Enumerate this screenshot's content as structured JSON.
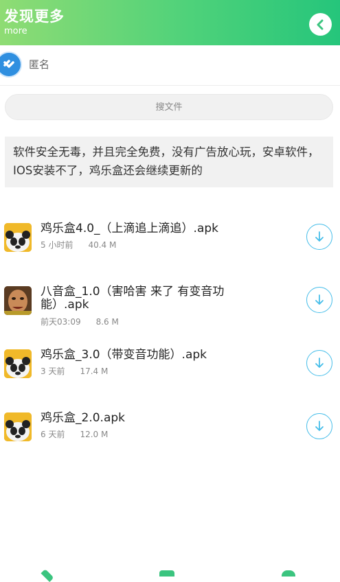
{
  "header": {
    "title": "发现更多",
    "subtitle": "more",
    "back_icon": "chevron-left-icon"
  },
  "user": {
    "name": "匿名",
    "avatar_icon": "user-avatar-icon"
  },
  "search": {
    "placeholder": "搜文件"
  },
  "description": "软件安全无毒，并且完全免费，没有广告放心玩，安卓软件，IOS安装不了，鸡乐盒还会继续更新的",
  "files": [
    {
      "name": "鸡乐盒4.0_（上滴追上滴追）.apk",
      "time": "5 小时前",
      "size": "40.4 M",
      "icon": "panda-app-icon"
    },
    {
      "name": "八音盒_1.0（害哈害 来了 有变音功能）.apk",
      "time": "前天03:09",
      "size": "8.6 M",
      "icon": "face-app-icon"
    },
    {
      "name": "鸡乐盒_3.0（带变音功能）.apk",
      "time": "3 天前",
      "size": "17.4 M",
      "icon": "panda-app-icon"
    },
    {
      "name": "鸡乐盒_2.0.apk",
      "time": "6 天前",
      "size": "12.0 M",
      "icon": "panda-app-icon"
    }
  ],
  "colors": {
    "accent_green": "#3bc47f",
    "download_blue": "#45bde9"
  }
}
